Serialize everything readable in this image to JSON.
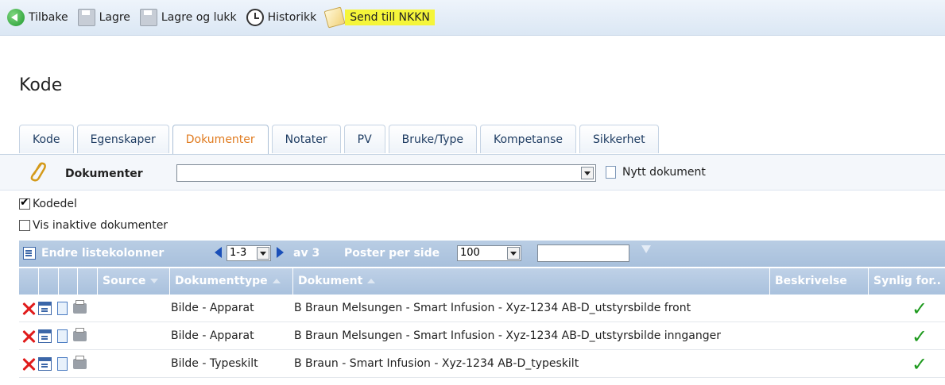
{
  "toolbar": {
    "back": "Tilbake",
    "save": "Lagre",
    "save_close": "Lagre og lukk",
    "history": "Historikk",
    "send": "Send till NKKN"
  },
  "page": {
    "title": "Kode"
  },
  "tabs": [
    "Kode",
    "Egenskaper",
    "Dokumenter",
    "Notater",
    "PV",
    "Bruke/Type",
    "Kompetanse",
    "Sikkerhet"
  ],
  "active_tab": "Dokumenter",
  "documents": {
    "label": "Dokumenter",
    "select_value": "",
    "new_doc": "Nytt dokument"
  },
  "filters": {
    "kodedel": {
      "label": "Kodedel",
      "checked": true
    },
    "inactive": {
      "label": "Vis inaktive dokumenter",
      "checked": false
    }
  },
  "grid": {
    "edit_columns": "Endre listekolonner",
    "page_range": "1-3",
    "of_total": "av 3",
    "per_page_label": "Poster per side",
    "per_page_value": "100",
    "filter_value": "",
    "columns": {
      "source": "Source",
      "doctype": "Dokumenttype",
      "document": "Dokument",
      "description": "Beskrivelse",
      "visible": "Synlig for.."
    },
    "rows": [
      {
        "doctype": "Bilde - Apparat",
        "document": "B Braun Melsungen - Smart Infusion - Xyz-1234 AB-D_utstyrsbilde front",
        "description": "",
        "visible": "✓"
      },
      {
        "doctype": "Bilde - Apparat",
        "document": "B Braun Melsungen - Smart Infusion - Xyz-1234 AB-D_utstyrsbilde innganger",
        "description": "",
        "visible": "✓"
      },
      {
        "doctype": "Bilde - Typeskilt",
        "document": "B Braun - Smart Infusion - Xyz-1234 AB-D_typeskilt",
        "description": "",
        "visible": "✓"
      }
    ]
  },
  "colors": {
    "highlight": "#f5f53a",
    "active_tab": "#e07b1f",
    "grid_header": "#a9c1dd",
    "check": "#1e9a1e"
  }
}
